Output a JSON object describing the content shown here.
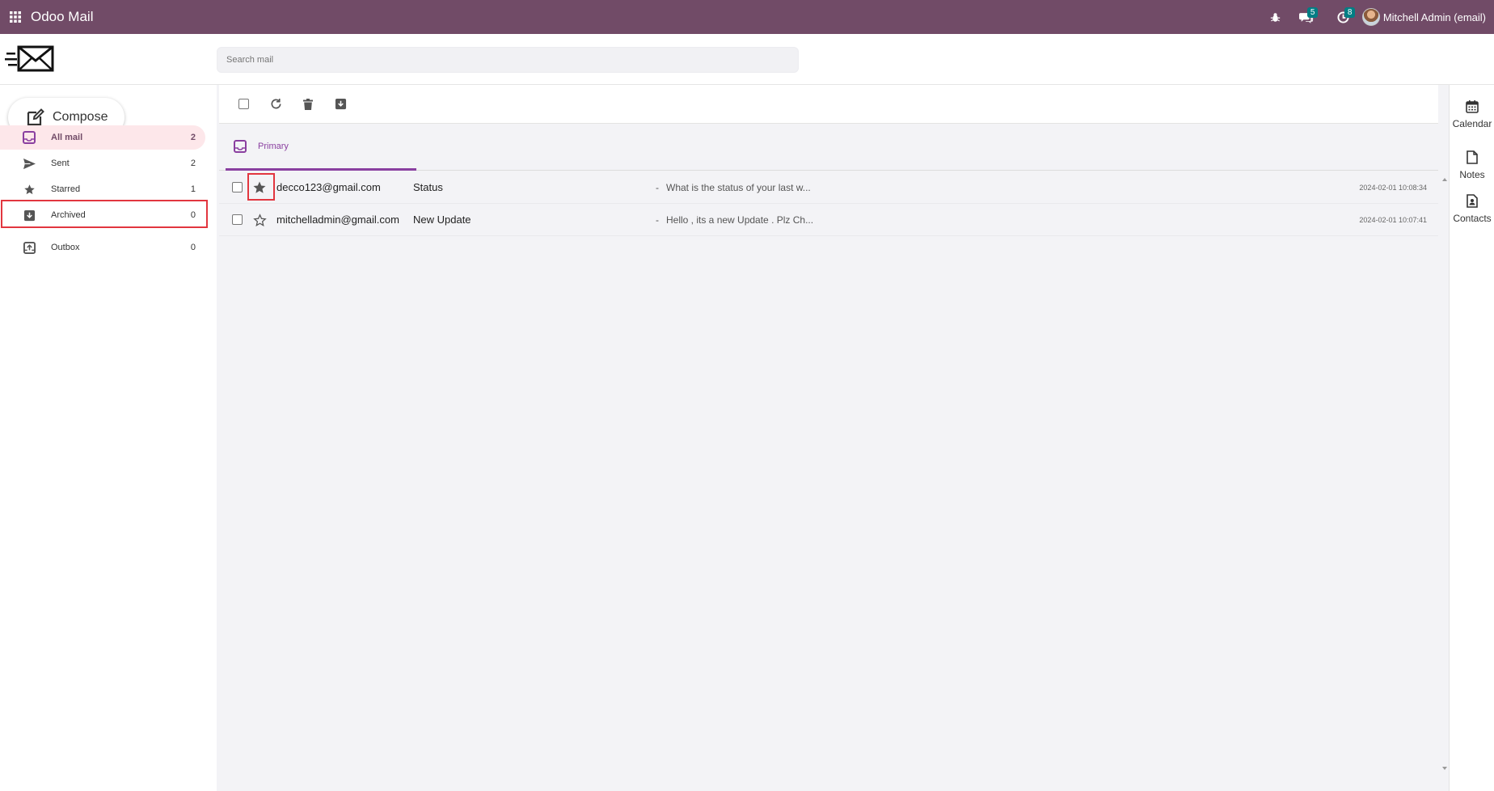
{
  "navbar": {
    "title": "Odoo Mail",
    "messages_badge": "5",
    "activities_badge": "8",
    "user_name": "Mitchell Admin (email)"
  },
  "search": {
    "placeholder": "Search mail"
  },
  "compose_label": "Compose",
  "sidebar": {
    "items": [
      {
        "label": "All mail",
        "count": "2",
        "icon": "inbox-icon"
      },
      {
        "label": "Sent",
        "count": "2",
        "icon": "send-icon"
      },
      {
        "label": "Starred",
        "count": "1",
        "icon": "star-icon"
      },
      {
        "label": "Archived",
        "count": "0",
        "icon": "archive-icon"
      },
      {
        "label": "Outbox",
        "count": "0",
        "icon": "outbox-icon"
      }
    ]
  },
  "tabs": {
    "primary_label": "Primary"
  },
  "mails": [
    {
      "from": "decco123@gmail.com",
      "subject": "Status",
      "dash": "-",
      "preview": "What is the status of your last w...",
      "date": "2024-02-01 10:08:34",
      "starred": true
    },
    {
      "from": "mitchelladmin@gmail.com",
      "subject": "New Update",
      "dash": "-",
      "preview": "Hello , its a new Update . Plz Ch...",
      "date": "2024-02-01 10:07:41",
      "starred": false
    }
  ],
  "rightbar": {
    "calendar": "Calendar",
    "notes": "Notes",
    "contacts": "Contacts"
  },
  "colors": {
    "navbar": "#714b67",
    "accent": "#8a3fa0",
    "badge": "#017e84",
    "highlight": "#e2363f",
    "active_bg": "#fde7ea"
  }
}
